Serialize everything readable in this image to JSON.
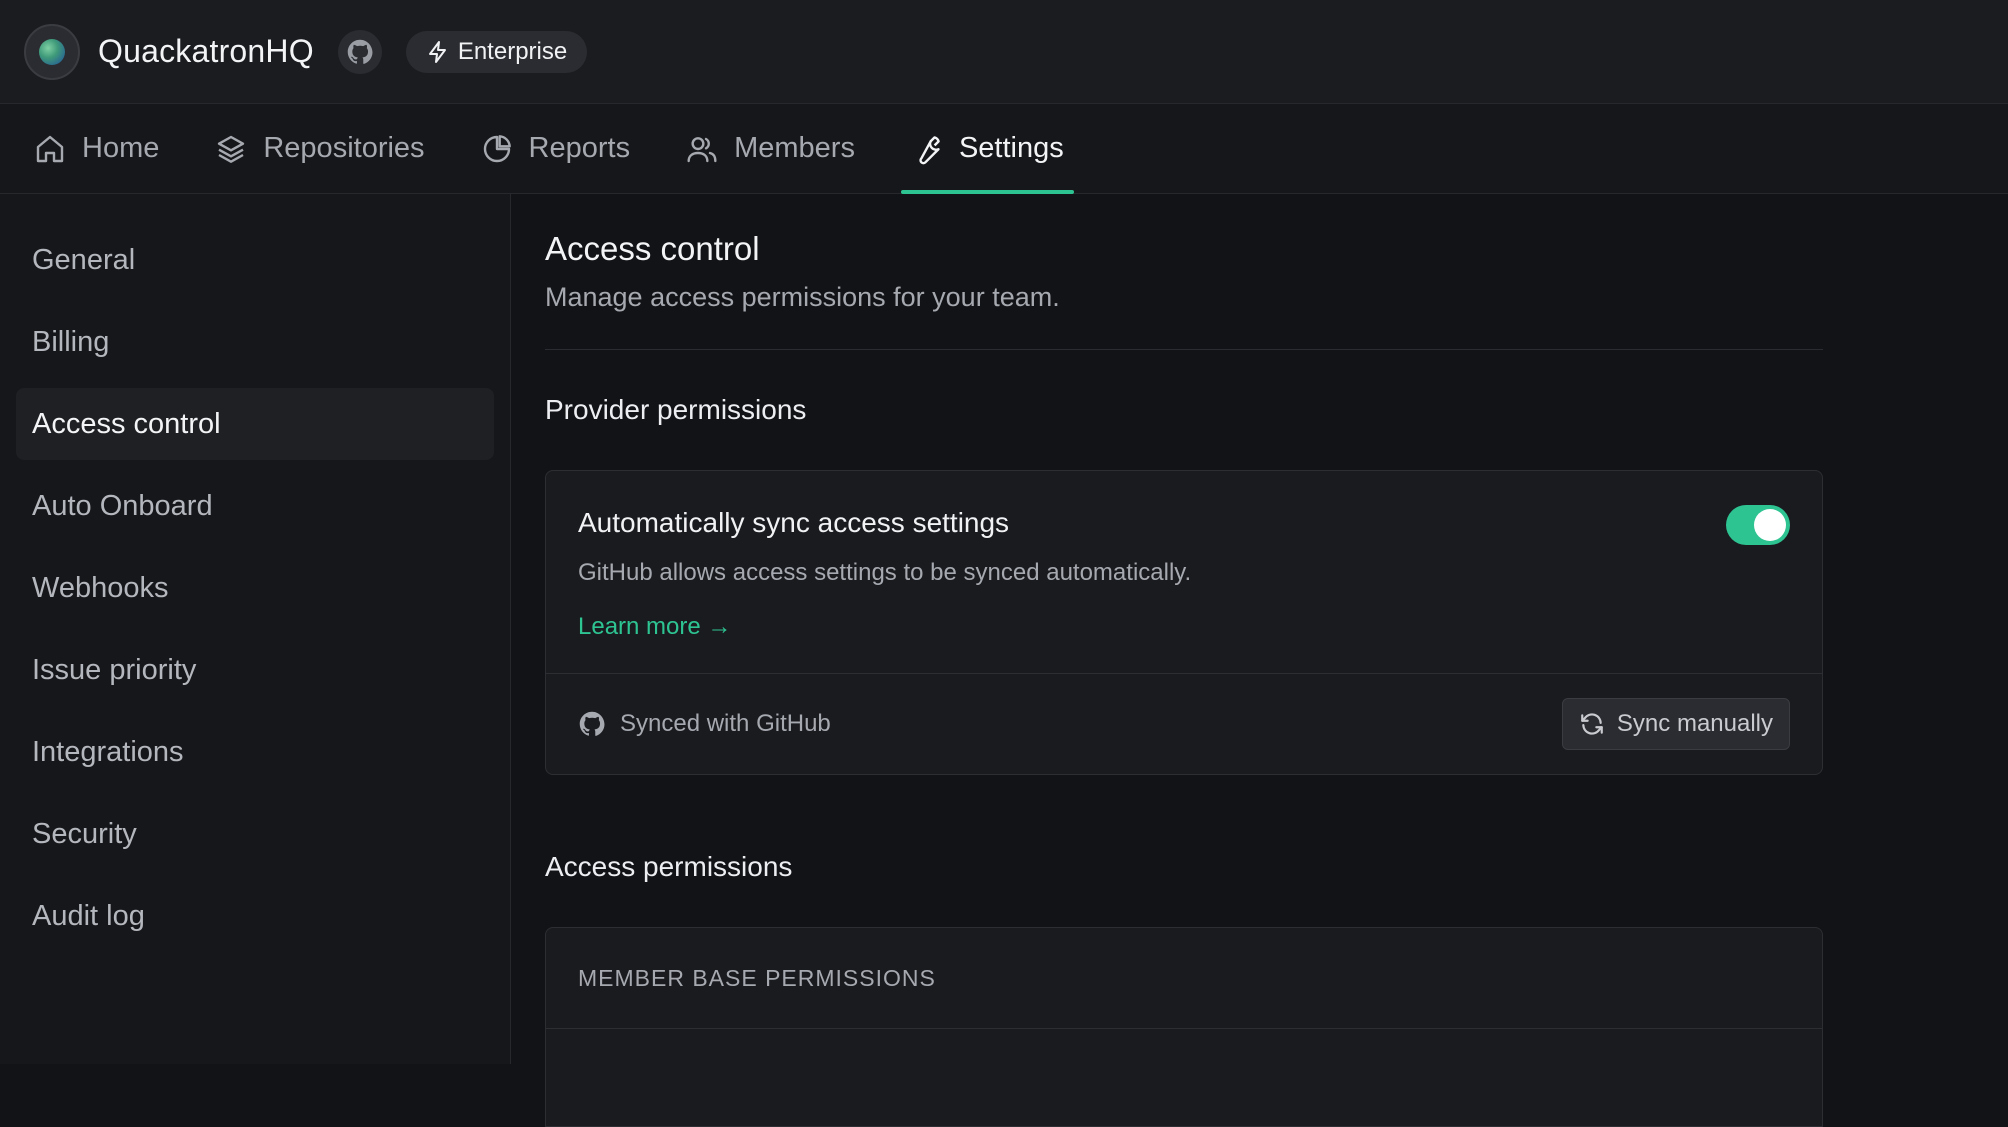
{
  "header": {
    "org_name": "QuackatronHQ",
    "plan_badge": "Enterprise",
    "icons": {
      "avatar": "globe-avatar",
      "github": "github-icon",
      "plan": "lightning-icon"
    }
  },
  "tabs": [
    {
      "label": "Home",
      "icon": "home-icon"
    },
    {
      "label": "Repositories",
      "icon": "layers-icon"
    },
    {
      "label": "Reports",
      "icon": "pie-chart-icon"
    },
    {
      "label": "Members",
      "icon": "users-icon"
    },
    {
      "label": "Settings",
      "icon": "wrench-icon",
      "active": true
    }
  ],
  "sidebar": {
    "items": [
      {
        "label": "General"
      },
      {
        "label": "Billing"
      },
      {
        "label": "Access control",
        "active": true
      },
      {
        "label": "Auto Onboard"
      },
      {
        "label": "Webhooks"
      },
      {
        "label": "Issue priority"
      },
      {
        "label": "Integrations"
      },
      {
        "label": "Security"
      },
      {
        "label": "Audit log"
      }
    ]
  },
  "main": {
    "title": "Access control",
    "subtitle": "Manage access permissions for your team.",
    "provider_section": {
      "title": "Provider permissions",
      "card": {
        "heading": "Automatically sync access settings",
        "description": "GitHub allows access settings to be synced automatically.",
        "link": "Learn more →",
        "toggle_on": true,
        "sync_status": "Synced with GitHub",
        "sync_button": "Sync manually"
      }
    },
    "access_section": {
      "title": "Access permissions",
      "table_header": "MEMBER BASE PERMISSIONS"
    }
  },
  "colors": {
    "accent": "#2ec492",
    "background": "#121316",
    "panel": "#1a1b1f"
  }
}
